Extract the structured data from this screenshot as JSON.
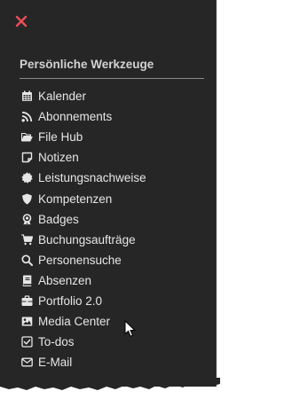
{
  "colors": {
    "panel_background": "#262626",
    "close_accent": "#e8505b",
    "text": "#e6e6e6",
    "heading_text": "#d2d2d2"
  },
  "close": {
    "icon": "close-icon"
  },
  "section": {
    "title": "Persönliche Werkzeuge"
  },
  "menu": {
    "items": [
      {
        "label": "Kalender",
        "icon": "calendar-icon"
      },
      {
        "label": "Abonnements",
        "icon": "rss-icon"
      },
      {
        "label": "File Hub",
        "icon": "folder-open-icon"
      },
      {
        "label": "Notizen",
        "icon": "note-icon"
      },
      {
        "label": "Leistungsnachweise",
        "icon": "certificate-icon"
      },
      {
        "label": "Kompetenzen",
        "icon": "shield-icon"
      },
      {
        "label": "Badges",
        "icon": "award-icon"
      },
      {
        "label": "Buchungsaufträge",
        "icon": "cart-icon"
      },
      {
        "label": "Personensuche",
        "icon": "search-icon"
      },
      {
        "label": "Absenzen",
        "icon": "book-icon"
      },
      {
        "label": "Portfolio 2.0",
        "icon": "briefcase-icon"
      },
      {
        "label": "Media Center",
        "icon": "image-icon"
      },
      {
        "label": "To-dos",
        "icon": "checkbox-icon"
      },
      {
        "label": "E-Mail",
        "icon": "envelope-icon"
      }
    ]
  }
}
